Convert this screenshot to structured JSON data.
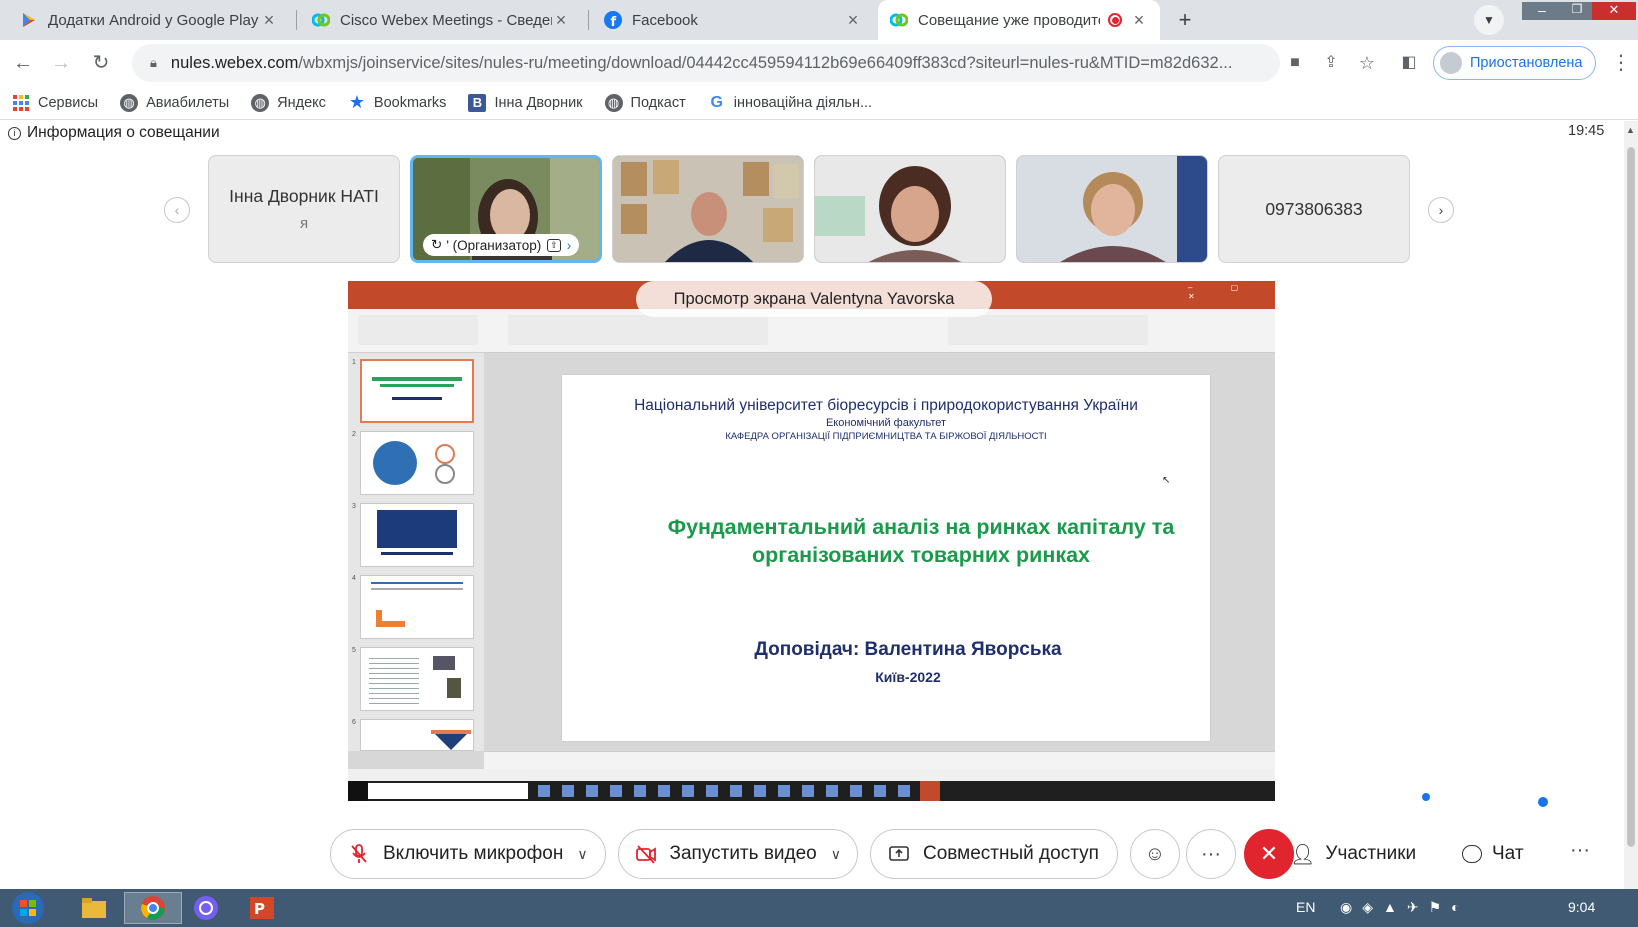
{
  "browser": {
    "tabs": [
      {
        "title": "Додатки Android у Google Play",
        "icon": "google-play-icon",
        "active": false
      },
      {
        "title": "Cisco Webex Meetings - Сведения",
        "icon": "webex-icon",
        "active": false
      },
      {
        "title": "Facebook",
        "icon": "facebook-icon",
        "active": false
      },
      {
        "title": "Совещание уже проводится",
        "icon": "webex-icon",
        "active": true,
        "recording": true
      }
    ],
    "url_host": "nules.webex.com",
    "url_rest": "/wbxmjs/joinservice/sites/nules-ru/meeting/download/04442cc459594112b69e66409ff383cd?siteurl=nules-ru&MTID=m82d632...",
    "profile_label": "Приостановлена",
    "bookmarks": [
      {
        "label": "Сервисы",
        "icon": "apps-grid-icon"
      },
      {
        "label": "Авиабилеты",
        "icon": "globe-icon"
      },
      {
        "label": "Яндекс",
        "icon": "globe-icon"
      },
      {
        "label": "Bookmarks",
        "icon": "star-icon"
      },
      {
        "label": "Інна Дворник",
        "icon": "b-bookmark-icon"
      },
      {
        "label": "Подкаст",
        "icon": "globe-icon"
      },
      {
        "label": "інноваційна діяльн...",
        "icon": "google-icon"
      }
    ]
  },
  "meeting": {
    "info_label": "Информация о совещании",
    "time": "19:45",
    "participants": [
      {
        "type": "name",
        "name": "Інна Дворник НАТІ",
        "sub": "я"
      },
      {
        "type": "video",
        "caption": "' (Организатор)",
        "selected": true
      },
      {
        "type": "video"
      },
      {
        "type": "video"
      },
      {
        "type": "video"
      },
      {
        "type": "name",
        "name": "0973806383",
        "sub": ""
      }
    ],
    "share_label": "Просмотр экрана Valentyna Yavorska",
    "slide": {
      "university": "Національний університет біоресурсів і природокористування України",
      "faculty": "Економічний факультет",
      "department": "КАФЕДРА ОРГАНІЗАЦІЇ ПІДПРИЄМНИЦТВА ТА БІРЖОВОЇ ДІЯЛЬНОСТІ",
      "title_line1": "Фундаментальний аналіз на ринках капіталу та",
      "title_line2": "організованих товарних ринках",
      "speaker": "Доповідач: Валентина Яворська",
      "city": "Київ-2022"
    },
    "slide_numbers": [
      "1",
      "2",
      "3",
      "4",
      "5",
      "6"
    ],
    "controls": {
      "mic": "Включить микрофон",
      "video": "Запустить видео",
      "share": "Совместный доступ",
      "participants": "Участники",
      "chat": "Чат",
      "more": "···"
    }
  },
  "taskbar": {
    "lang": "EN",
    "clock": "9:04"
  },
  "colors": {
    "accent_blue": "#1a73e8",
    "leave_red": "#e0252f",
    "slide_green": "#1a9a4a",
    "slide_navy": "#1f2f6b",
    "ppt_orange": "#c2492a"
  }
}
